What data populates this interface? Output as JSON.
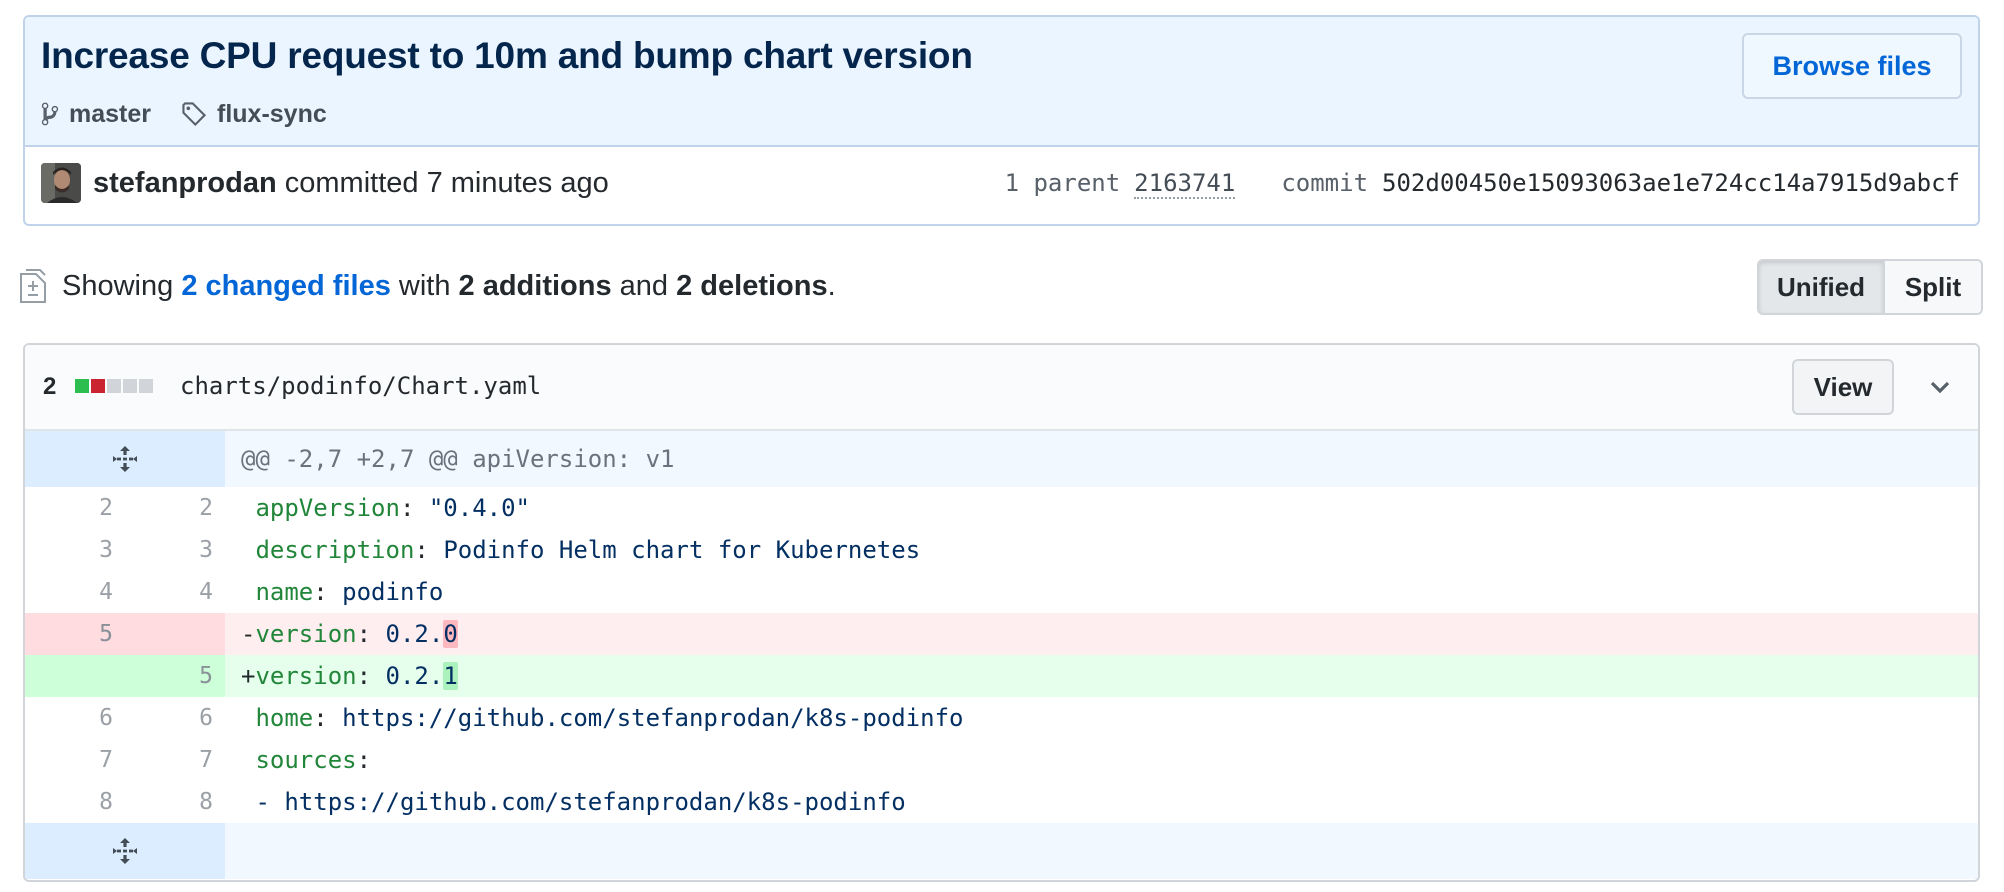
{
  "commit": {
    "title": "Increase CPU request to 10m and bump chart version",
    "branch": "master",
    "tag": "flux-sync",
    "browse_label": "Browse files",
    "author": "stefanprodan",
    "committed_text": "committed 7 minutes ago",
    "parent_label": "1 parent",
    "parent_sha": "2163741",
    "commit_label": "commit",
    "commit_sha": "502d00450e15093063ae1e724cc14a7915d9abcf"
  },
  "summary": {
    "prefix": "Showing",
    "changed_files": "2 changed files",
    "with": "with",
    "additions": "2 additions",
    "and": "and",
    "deletions": "2 deletions",
    "end": "."
  },
  "view_toggle": {
    "unified": "Unified",
    "split": "Split",
    "selected": "Unified"
  },
  "file": {
    "change_count": "2",
    "diffstat": {
      "additions": 1,
      "deletions": 1,
      "neutral": 3
    },
    "colors": {
      "add": "#2cbe4e",
      "del": "#cb2431",
      "neutral": "#d1d5da"
    },
    "path": "charts/podinfo/Chart.yaml",
    "view_label": "View",
    "hunk_header": "@@ -2,7 +2,7 @@ apiVersion: v1",
    "lines": [
      {
        "type": "ctx",
        "old": "2",
        "new": "2",
        "sign": " ",
        "key": "appVersion",
        "sep": ": ",
        "value": "\"0.4.0\""
      },
      {
        "type": "ctx",
        "old": "3",
        "new": "3",
        "sign": " ",
        "key": "description",
        "sep": ": ",
        "value": "Podinfo Helm chart for Kubernetes"
      },
      {
        "type": "ctx",
        "old": "4",
        "new": "4",
        "sign": " ",
        "key": "name",
        "sep": ": ",
        "value": "podinfo"
      },
      {
        "type": "del",
        "old": "5",
        "new": "",
        "sign": "-",
        "key": "version",
        "sep": ": ",
        "value": "0.2.",
        "hl": "0"
      },
      {
        "type": "add",
        "old": "",
        "new": "5",
        "sign": "+",
        "key": "version",
        "sep": ": ",
        "value": "0.2.",
        "hl": "1"
      },
      {
        "type": "ctx",
        "old": "6",
        "new": "6",
        "sign": " ",
        "key": "home",
        "sep": ": ",
        "value": "https://github.com/stefanprodan/k8s-podinfo"
      },
      {
        "type": "ctx",
        "old": "7",
        "new": "7",
        "sign": " ",
        "key": "sources",
        "sep": ":",
        "value": ""
      },
      {
        "type": "ctx",
        "old": "8",
        "new": "8",
        "sign": " ",
        "key": "",
        "sep": "",
        "value": "- https://github.com/stefanprodan/k8s-podinfo"
      }
    ]
  }
}
